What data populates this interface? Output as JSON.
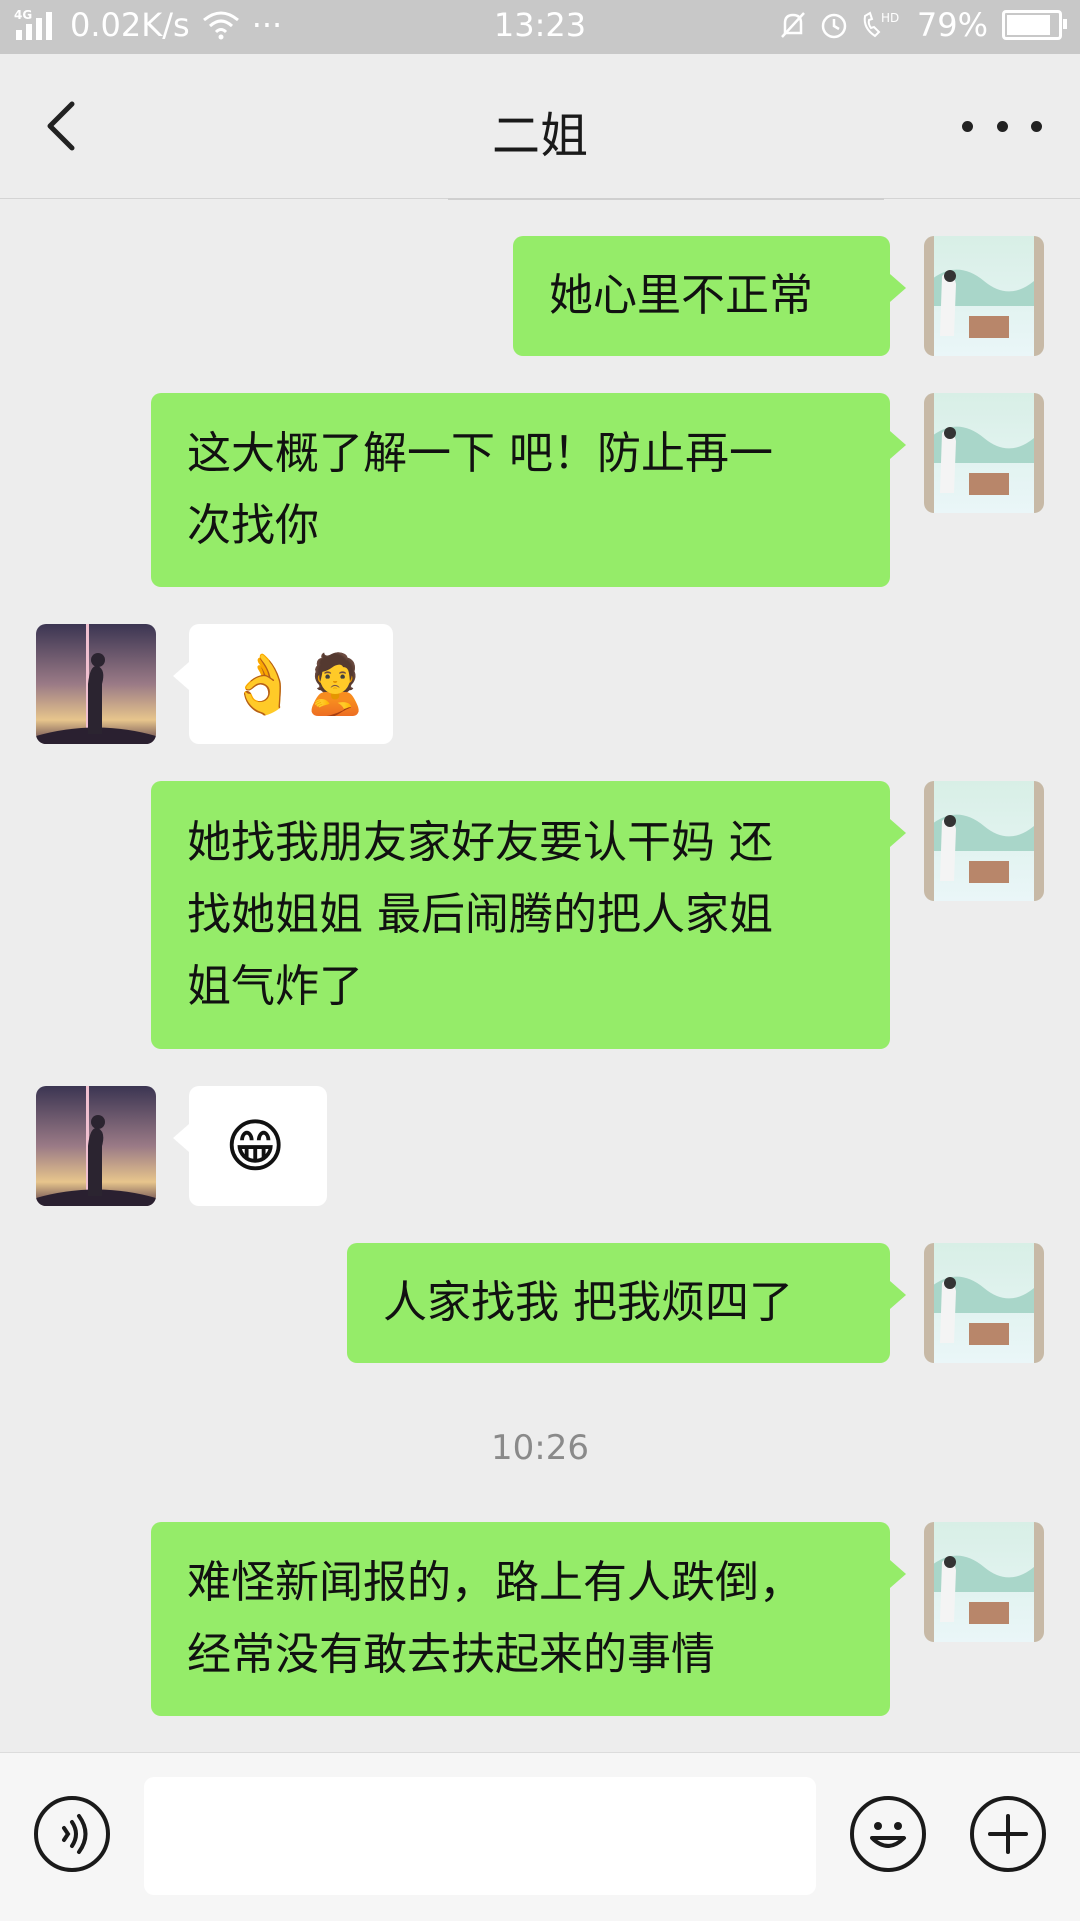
{
  "status_bar": {
    "network": "4G",
    "speed": "0.02K/s",
    "dots": "···",
    "time": "13:23",
    "hd": "HD",
    "battery_text": "79%",
    "battery_level": 0.79
  },
  "header": {
    "title": "二姐",
    "back_icon": "chevron-left-icon",
    "more_icon": "more-icon"
  },
  "messages": [
    {
      "side": "out",
      "text": "她心里不正常"
    },
    {
      "side": "out",
      "lines": [
        "这大概了解一下 吧！防止再一",
        "次找你"
      ]
    },
    {
      "side": "in",
      "emoji": "👌🙎"
    },
    {
      "side": "out",
      "lines": [
        "她找我朋友家好友要认干妈 还",
        "找她姐姐 最后闹腾的把人家姐",
        "姐气炸了"
      ]
    },
    {
      "side": "in",
      "emoji": "😁"
    },
    {
      "side": "out",
      "text": "人家找我 把我烦四了"
    },
    {
      "side": "out",
      "lines": [
        "难怪新闻报的，路上有人跌倒，",
        "经常没有敢去扶起来的事情"
      ]
    }
  ],
  "timestamp": "10:26",
  "input": {
    "value": "",
    "voice_icon": "voice-icon",
    "emoji_icon": "smiley-icon",
    "add_icon": "plus-icon"
  }
}
